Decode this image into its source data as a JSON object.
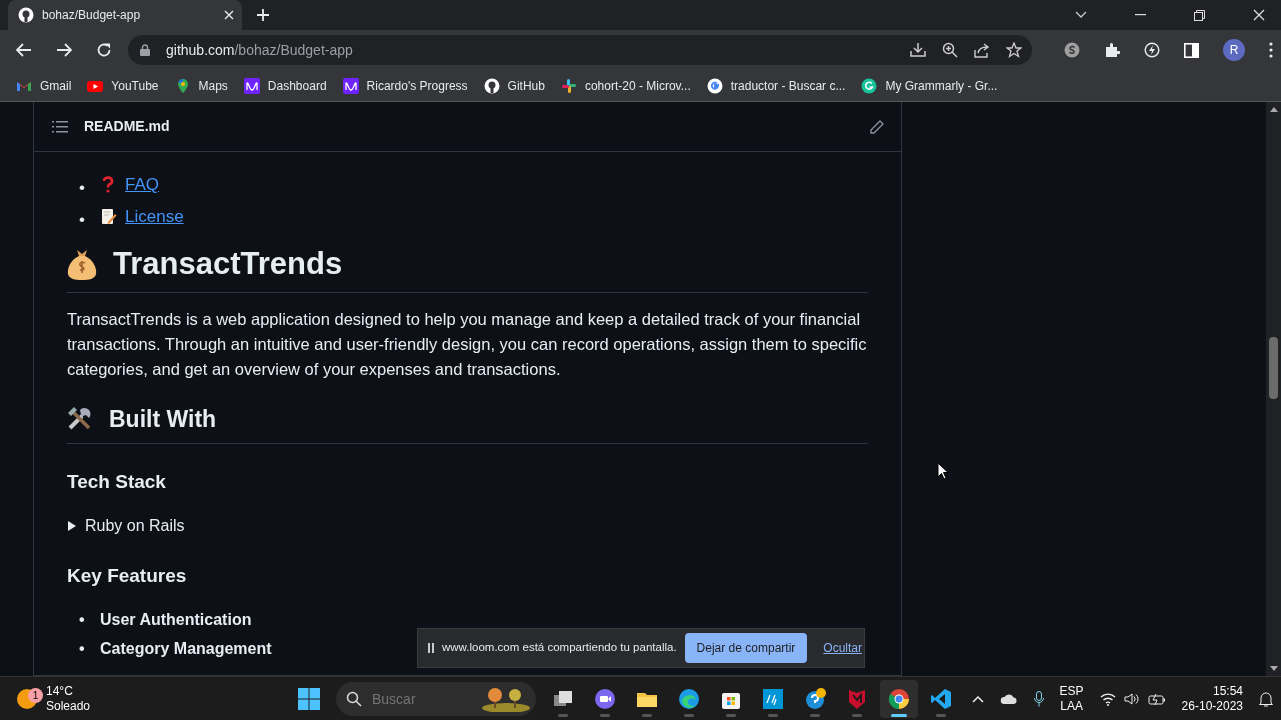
{
  "browser": {
    "tabs": [
      {
        "title": "bohaz/Budget-app",
        "selected": true
      }
    ],
    "address": {
      "host": "github.com",
      "path": "/bohaz/Budget-app"
    },
    "bookmarks": [
      {
        "label": "Gmail",
        "kind": "gmail"
      },
      {
        "label": "YouTube",
        "kind": "youtube"
      },
      {
        "label": "Maps",
        "kind": "maps"
      },
      {
        "label": "Dashboard",
        "kind": "microverse"
      },
      {
        "label": "Ricardo's Progress",
        "kind": "microverse"
      },
      {
        "label": "GitHub",
        "kind": "github"
      },
      {
        "label": "cohort-20 - Microv...",
        "kind": "slack"
      },
      {
        "label": "traductor - Buscar c...",
        "kind": "google"
      },
      {
        "label": "My Grammarly - Gr...",
        "kind": "grammarly"
      }
    ],
    "profile_initial": "R"
  },
  "readme": {
    "file_name": "README.md",
    "bullet": "•",
    "toc_links": [
      {
        "label": "FAQ",
        "kind": "question"
      },
      {
        "label": "License",
        "kind": "memo"
      }
    ],
    "title": "TransactTrends",
    "description": "TransactTrends is a web application designed to help you manage and keep a detailed track of your financial transactions. Through an intuitive and user-friendly design, you can record operations, assign them to specific categories, and get an overview of your expenses and transactions.",
    "built_with": "Built With",
    "tech_stack": "Tech Stack",
    "stack_items": [
      {
        "label": "Ruby on Rails",
        "expanded": false
      }
    ],
    "key_features": "Key Features",
    "features": [
      "User Authentication",
      "Category Management"
    ]
  },
  "share_bar": {
    "message": "www.loom.com está compartiendo tu pantalla.",
    "stop_button": "Dejar de compartir",
    "hide_link": "Ocultar"
  },
  "taskbar": {
    "weather": {
      "temperature": "14°C",
      "condition": "Soleado",
      "badge": "1"
    },
    "search_placeholder": "Buscar",
    "apps": [
      {
        "kind": "taskview",
        "selected": false
      },
      {
        "kind": "meet",
        "selected": false
      },
      {
        "kind": "folder",
        "selected": false
      },
      {
        "kind": "edge",
        "selected": false
      },
      {
        "kind": "store",
        "selected": false
      },
      {
        "kind": "hp",
        "selected": false
      },
      {
        "kind": "help",
        "selected": false
      },
      {
        "kind": "shield",
        "selected": false
      },
      {
        "kind": "chrome",
        "selected": true
      },
      {
        "kind": "vscode",
        "selected": false
      }
    ],
    "language": "ESP",
    "layout": "LAA",
    "time": "15:54",
    "date": "26-10-2023"
  }
}
